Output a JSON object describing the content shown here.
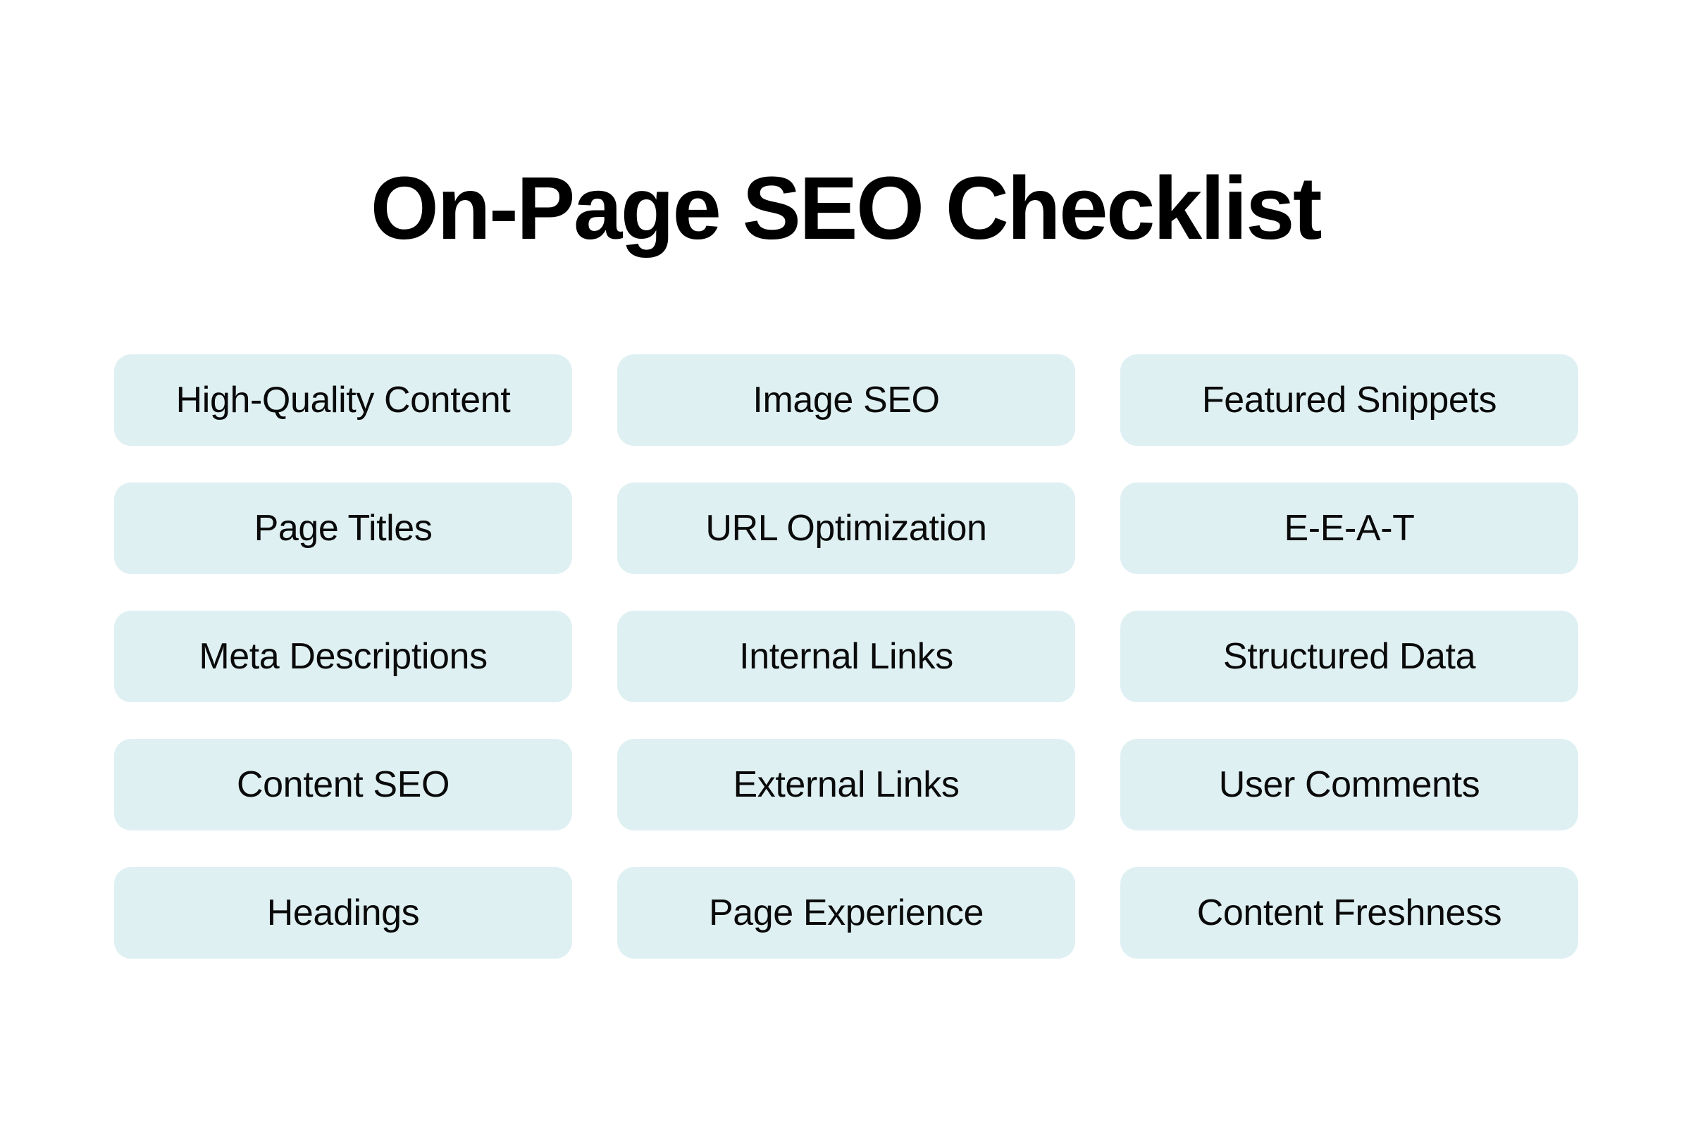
{
  "page": {
    "title": "On-Page SEO Checklist",
    "background_color": "#ffffff",
    "title_color": "#000000",
    "pill_color": "#dff0f3",
    "pill_text_color": "#0a0a0a"
  },
  "checklist": {
    "columns": [
      {
        "name": "column-1",
        "items": [
          {
            "label": "High-Quality Content"
          },
          {
            "label": "Page Titles"
          },
          {
            "label": "Meta Descriptions"
          },
          {
            "label": "Content SEO"
          },
          {
            "label": "Headings"
          }
        ]
      },
      {
        "name": "column-2",
        "items": [
          {
            "label": "Image SEO"
          },
          {
            "label": "URL Optimization"
          },
          {
            "label": "Internal Links"
          },
          {
            "label": "External Links"
          },
          {
            "label": "Page Experience"
          }
        ]
      },
      {
        "name": "column-3",
        "items": [
          {
            "label": "Featured Snippets"
          },
          {
            "label": "E-E-A-T"
          },
          {
            "label": "Structured Data"
          },
          {
            "label": "User Comments"
          },
          {
            "label": "Content Freshness"
          }
        ]
      }
    ],
    "rows": [
      [
        "High-Quality Content",
        "Image SEO",
        "Featured Snippets"
      ],
      [
        "Page Titles",
        "URL Optimization",
        "E-E-A-T"
      ],
      [
        "Meta Descriptions",
        "Internal Links",
        "Structured Data"
      ],
      [
        "Content SEO",
        "External Links",
        "User Comments"
      ],
      [
        "Headings",
        "Page Experience",
        "Content Freshness"
      ]
    ]
  }
}
